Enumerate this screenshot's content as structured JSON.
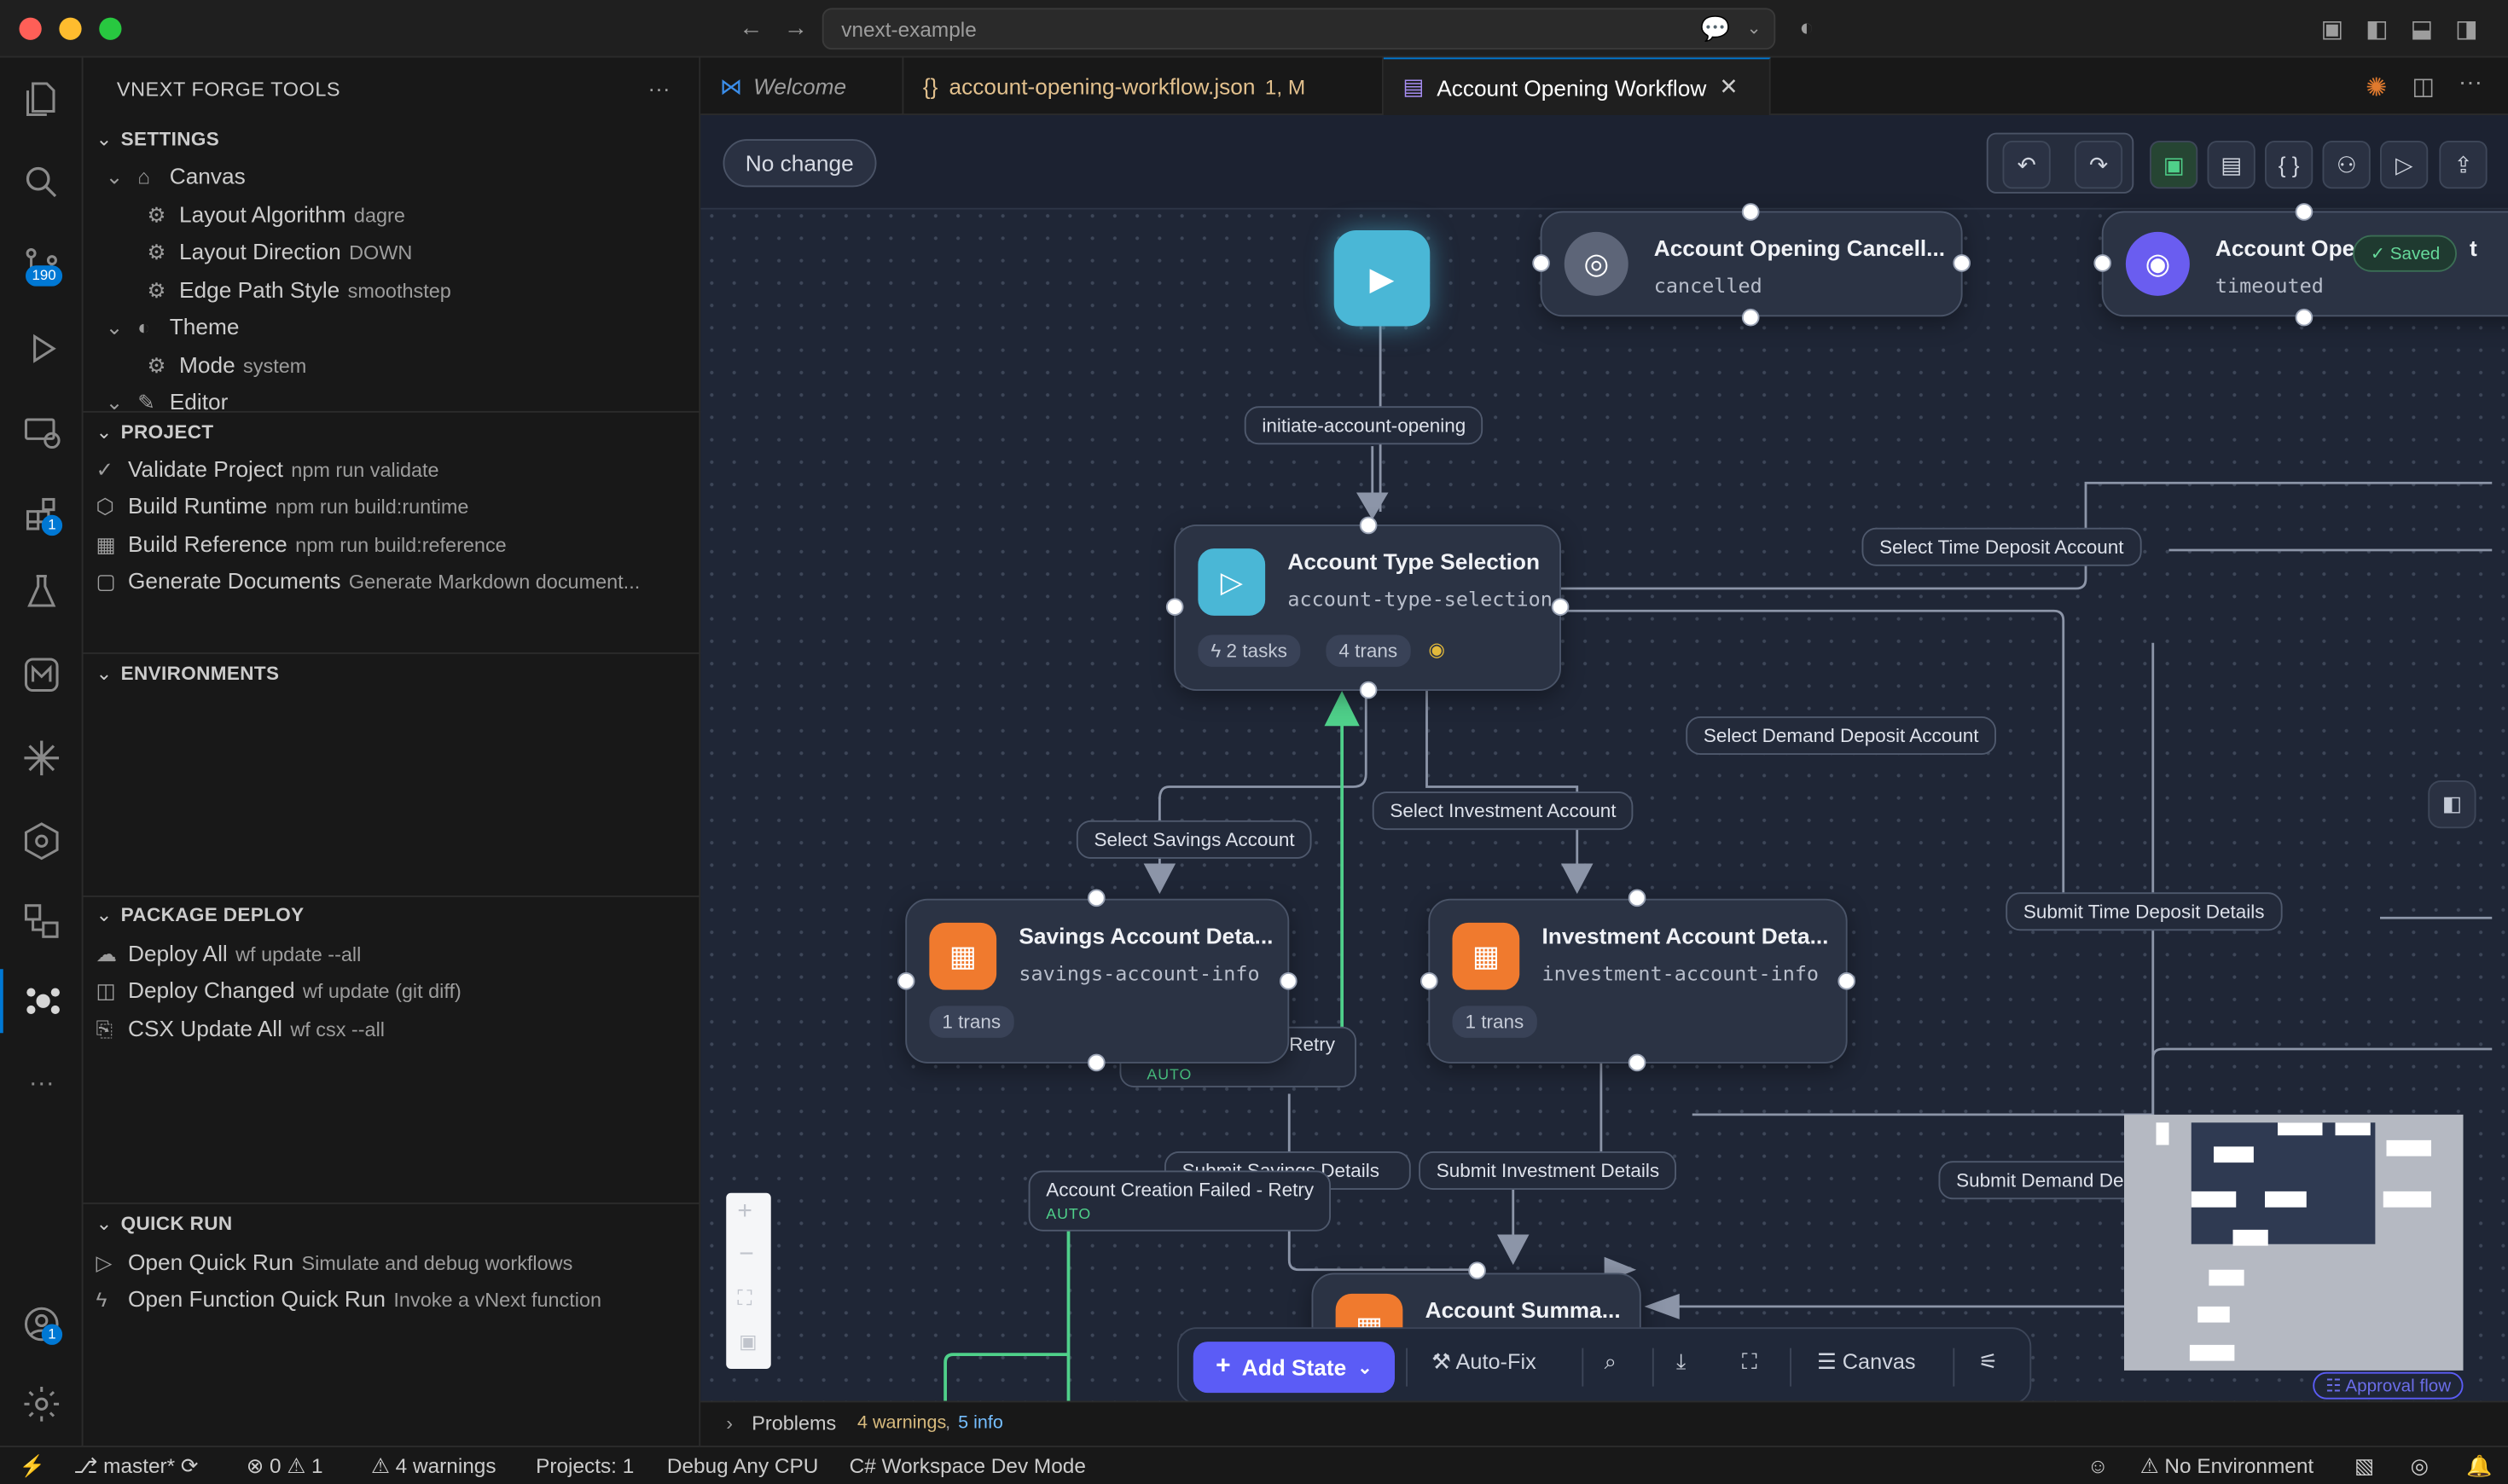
{
  "window": {
    "search_text": "vnext-example"
  },
  "activity": {
    "scm_badge": "190",
    "extensions_badge": "1",
    "account_badge": "1"
  },
  "sidebar": {
    "title": "VNEXT FORGE TOOLS",
    "more": "···",
    "settings": {
      "header": "SETTINGS",
      "canvas": "Canvas",
      "layout_algorithm": {
        "label": "Layout Algorithm",
        "value": "dagre"
      },
      "layout_direction": {
        "label": "Layout Direction",
        "value": "DOWN"
      },
      "edge_path_style": {
        "label": "Edge Path Style",
        "value": "smoothstep"
      },
      "theme": "Theme",
      "mode": {
        "label": "Mode",
        "value": "system"
      },
      "editor": "Editor"
    },
    "project": {
      "header": "PROJECT",
      "items": [
        {
          "label": "Validate Project",
          "desc": "npm run validate"
        },
        {
          "label": "Build Runtime",
          "desc": "npm run build:runtime"
        },
        {
          "label": "Build Reference",
          "desc": "npm run build:reference"
        },
        {
          "label": "Generate Documents",
          "desc": "Generate Markdown document..."
        }
      ]
    },
    "environments": {
      "header": "ENVIRONMENTS"
    },
    "package_deploy": {
      "header": "PACKAGE DEPLOY",
      "items": [
        {
          "label": "Deploy All",
          "desc": "wf update --all"
        },
        {
          "label": "Deploy Changed",
          "desc": "wf update (git diff)"
        },
        {
          "label": "CSX Update All",
          "desc": "wf csx --all"
        }
      ]
    },
    "quick_run": {
      "header": "QUICK RUN",
      "items": [
        {
          "label": "Open Quick Run",
          "desc": "Simulate and debug workflows"
        },
        {
          "label": "Open Function Quick Run",
          "desc": "Invoke a vNext function"
        }
      ]
    }
  },
  "tabs": [
    {
      "label": "Welcome"
    },
    {
      "label": "account-opening-workflow.json",
      "meta": "1, M"
    },
    {
      "label": "Account Opening Workflow"
    }
  ],
  "canvas": {
    "change_status": "No change",
    "saved_badge": "Saved",
    "nodes": {
      "cancelled": {
        "title": "Account Opening Cancell...",
        "key": "cancelled"
      },
      "timeouted": {
        "title": "Account Oper",
        "title_suffix": "t",
        "key": "timeouted"
      },
      "type_selection": {
        "title": "Account Type Selection",
        "key": "account-type-selection",
        "tasks": "2 tasks",
        "trans": "4 trans"
      },
      "savings": {
        "title": "Savings Account Deta...",
        "key": "savings-account-info",
        "trans": "1 trans"
      },
      "investment": {
        "title": "Investment Account Deta...",
        "key": "investment-account-info",
        "trans": "1 trans"
      },
      "summary": {
        "title": "Account Summa..."
      }
    },
    "edges": {
      "initiate": "initiate-account-opening",
      "time_deposit": "Select Time Deposit Account",
      "demand_deposit": "Select Demand Deposit Account",
      "investment": "Select Investment Account",
      "savings": "Select Savings Account",
      "retry": "Retry",
      "auto": "AUTO",
      "submit_time_deposit": "Submit Time Deposit Details",
      "submit_investment": "Submit Investment Details",
      "submit_savings_partial": "Submit Savings Details",
      "submit_demand": "Submit Demand Deposit Details",
      "creation_failed": "Account Creation Failed - Retry",
      "creation_failed_auto": "AUTO"
    },
    "bottom": {
      "add_state": "Add State",
      "auto_fix": "Auto-Fix",
      "canvas": "Canvas"
    },
    "approval_flow": "Approval flow"
  },
  "problems": {
    "label": "Problems",
    "warnings": "4 warnings",
    "info": "5 info"
  },
  "status": {
    "branch": "master*",
    "errors": "0",
    "warn_count": "1",
    "warnings": "4 warnings",
    "projects": "Projects: 1",
    "debug": "Debug Any CPU",
    "workspace": "C# Workspace Dev Mode",
    "environment": "No Environment"
  },
  "colors": {
    "accent": "#5b5cf6",
    "orange": "#f07a2e",
    "teal": "#4ab7d6",
    "green": "#4fd08a",
    "purple": "#6a5df0"
  }
}
